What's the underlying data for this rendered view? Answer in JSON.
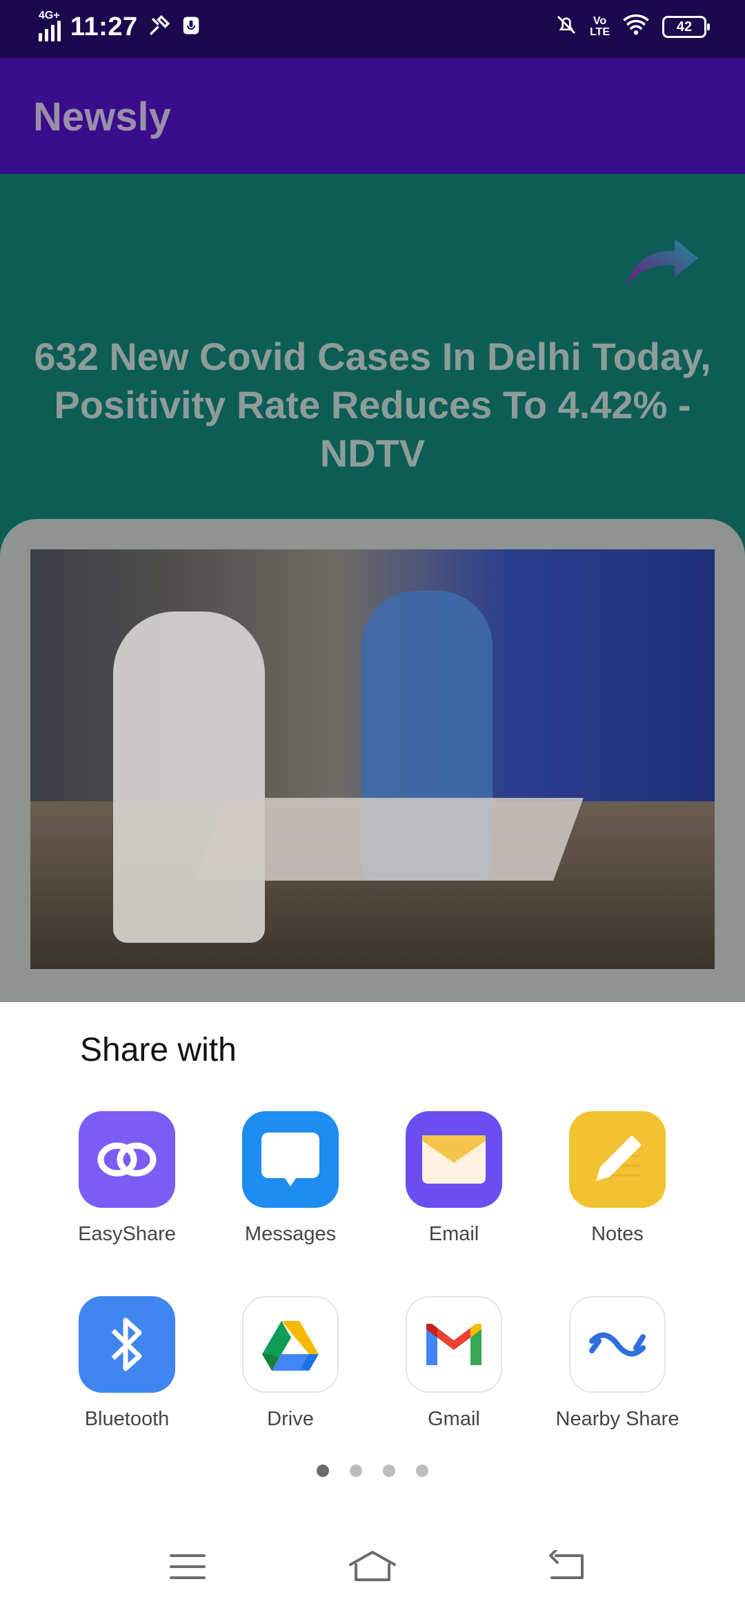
{
  "status_bar": {
    "network": "4G+",
    "time": "11:27",
    "battery": "42",
    "icons": [
      "signal-icon",
      "tools-icon",
      "mic-icon",
      "mute-icon",
      "volte-icon",
      "wifi-icon",
      "battery-icon"
    ]
  },
  "app_bar": {
    "title": "Newsly"
  },
  "article": {
    "headline": "632 New Covid Cases In Delhi Today, Positivity Rate Reduces To 4.42% - NDTV",
    "image_icon": "news-photo",
    "share_icon": "share-arrow-icon"
  },
  "share_sheet": {
    "title": "Share with",
    "apps": [
      {
        "label": "EasyShare",
        "icon": "easyshare-icon",
        "color": "#7b5cf5"
      },
      {
        "label": "Messages",
        "icon": "messages-icon",
        "color": "#1e8cf0"
      },
      {
        "label": "Email",
        "icon": "email-icon",
        "color": "#6a4ef0"
      },
      {
        "label": "Notes",
        "icon": "notes-icon",
        "color": "#f1c232"
      },
      {
        "label": "Bluetooth",
        "icon": "bluetooth-icon",
        "color": "#3f86f0"
      },
      {
        "label": "Drive",
        "icon": "drive-icon",
        "color": "#ffffff"
      },
      {
        "label": "Gmail",
        "icon": "gmail-icon",
        "color": "#ffffff"
      },
      {
        "label": "Nearby Share",
        "icon": "nearby-share-icon",
        "color": "#ffffff"
      }
    ],
    "pages": 4,
    "current_page": 1
  },
  "nav_bar": {
    "icons": [
      "menu-icon",
      "home-icon",
      "back-icon"
    ]
  }
}
